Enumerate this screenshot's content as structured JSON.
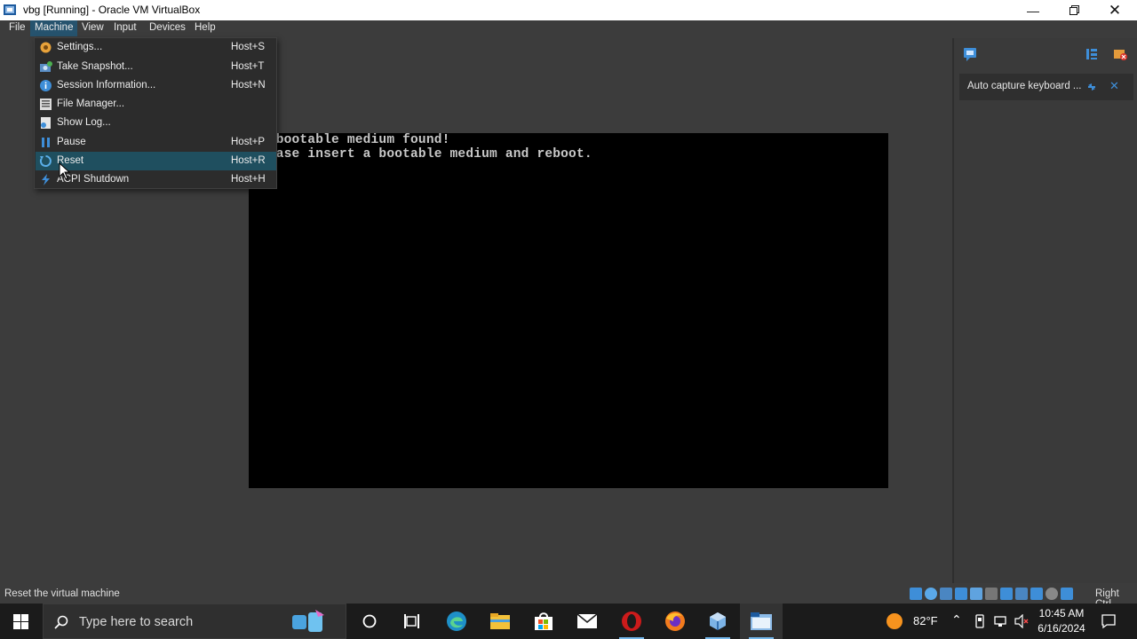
{
  "window": {
    "title": "vbg [Running] - Oracle VM VirtualBox",
    "minimize_icon": "minimize-icon",
    "maximize_icon": "restore-icon",
    "close_icon": "close-icon"
  },
  "menubar": {
    "items": [
      {
        "label": "File"
      },
      {
        "label": "Machine"
      },
      {
        "label": "View"
      },
      {
        "label": "Input"
      },
      {
        "label": "Devices"
      },
      {
        "label": "Help"
      }
    ]
  },
  "machine_menu": {
    "items": [
      {
        "label": "Settings...",
        "shortcut": "Host+S",
        "icon": "settings-gear-icon"
      },
      {
        "label": "Take Snapshot...",
        "shortcut": "Host+T",
        "icon": "snapshot-icon"
      },
      {
        "label": "Session Information...",
        "shortcut": "Host+N",
        "icon": "info-icon"
      },
      {
        "label": "File Manager...",
        "shortcut": "",
        "icon": "file-manager-icon"
      },
      {
        "label": "Show Log...",
        "shortcut": "",
        "icon": "log-icon"
      },
      {
        "label": "Pause",
        "shortcut": "Host+P",
        "icon": "pause-icon"
      },
      {
        "label": "Reset",
        "shortcut": "Host+R",
        "icon": "reset-icon",
        "highlighted": true
      },
      {
        "label": "ACPI Shutdown",
        "shortcut": "Host+H",
        "icon": "acpi-shutdown-icon"
      }
    ]
  },
  "vm_console": {
    "lines": [
      "No bootable medium found!",
      "Please insert a bootable medium and reboot."
    ]
  },
  "right_panel": {
    "notice_text": "Auto capture keyboard ..."
  },
  "statusbar": {
    "text": "Reset the virtual machine",
    "host_key": "Right Ctrl"
  },
  "taskbar": {
    "search_placeholder": "Type here to search",
    "weather": "82°F",
    "time": "10:45 AM",
    "date": "6/16/2024"
  },
  "colors": {
    "menu_highlight": "#1f4f5f",
    "accent": "#26536e",
    "taskbar_bg": "#1b1b1b"
  }
}
